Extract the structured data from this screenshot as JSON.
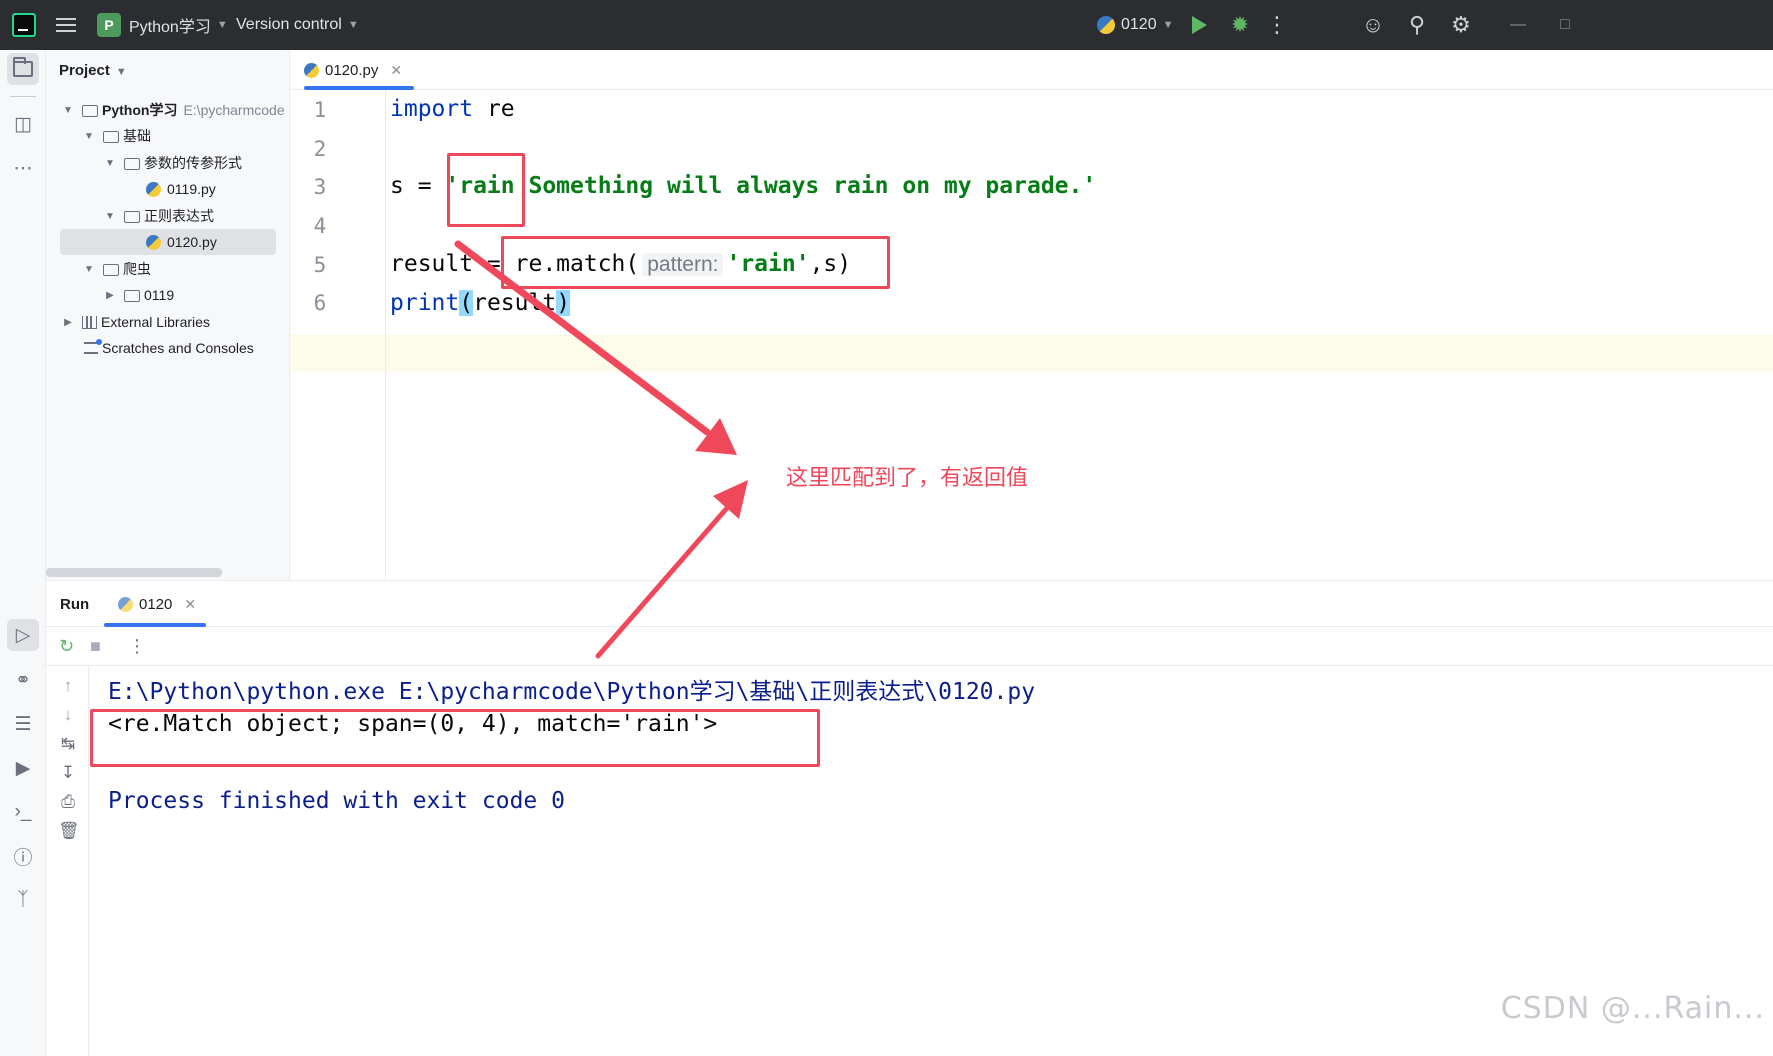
{
  "titlebar": {
    "project_badge": "P",
    "project_name": "Python学习",
    "vcs": "Version control",
    "run_config": "0120",
    "icons": [
      "hamburger-icon",
      "run-icon",
      "debug-icon",
      "more-icon",
      "add-user-icon",
      "search-icon",
      "settings-icon",
      "minimize-icon"
    ]
  },
  "toolstrip": {
    "top_icons": [
      "project-icon",
      "structure-icon",
      "more-icon"
    ],
    "bottom_icons": [
      "run-icon",
      "python-console-icon",
      "layers-icon",
      "services-icon",
      "terminal-icon",
      "problems-icon",
      "git-icon"
    ]
  },
  "project": {
    "header": "Project",
    "tree": [
      {
        "label": "Python学习",
        "note": "E:\\pycharmcode",
        "expanded": true
      },
      {
        "label": "基础",
        "expanded": true
      },
      {
        "label": "参数的传参形式",
        "expanded": true
      },
      {
        "label": "0119.py"
      },
      {
        "label": "正则表达式",
        "expanded": true
      },
      {
        "label": "0120.py",
        "selected": true
      },
      {
        "label": "爬虫",
        "expanded": true
      },
      {
        "label": "0119",
        "expanded": false
      },
      {
        "label": "External Libraries",
        "expanded": false
      },
      {
        "label": "Scratches and Consoles"
      }
    ]
  },
  "editor": {
    "tab": "0120.py",
    "line_numbers": [
      "1",
      "2",
      "3",
      "4",
      "5",
      "6"
    ],
    "code": {
      "l1_kw": "import",
      "l1_rest": " re",
      "l3_pre": "s = ",
      "l3_str": "'rain Something will always rain on my parade.'",
      "l5_pre": "result = re.match(",
      "l5_hint": "pattern:",
      "l5_str": "'rain'",
      "l5_post": ",s)",
      "l6_fn": "print",
      "l6_open": "(",
      "l6_arg": "result",
      "l6_close": ")"
    }
  },
  "run": {
    "title": "Run",
    "tab": "0120",
    "console": {
      "cmd": "E:\\Python\\python.exe E:\\pycharmcode\\Python学习\\基础\\正则表达式\\0120.py",
      "result": "<re.Match object; span=(0, 4), match='rain'>",
      "exit": "Process finished with exit code 0"
    }
  },
  "annotation": {
    "text": "这里匹配到了，有返回值",
    "color": "#f0485b"
  },
  "watermark": "CSDN @...Rain..."
}
